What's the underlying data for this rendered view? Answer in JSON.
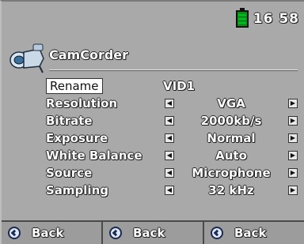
{
  "status": {
    "clock": "16 58",
    "battery_color": "#0b8f1b"
  },
  "app": {
    "title": "CamCorder",
    "icon": "camcorder-icon"
  },
  "settings": {
    "rename": {
      "label": "Rename",
      "value": "VID1"
    },
    "rows": [
      {
        "label": "Resolution",
        "value": "VGA"
      },
      {
        "label": "Bitrate",
        "value": "2000kb/s"
      },
      {
        "label": "Exposure",
        "value": "Normal"
      },
      {
        "label": "White Balance",
        "value": "Auto"
      },
      {
        "label": "Source",
        "value": "Microphone"
      },
      {
        "label": "Sampling",
        "value": "32 kHz"
      }
    ]
  },
  "bottom_bar": {
    "buttons": [
      {
        "label": "Back",
        "icon": "back-icon"
      },
      {
        "label": "Back",
        "icon": "back-icon"
      },
      {
        "label": "Back",
        "icon": "back-icon"
      }
    ]
  }
}
